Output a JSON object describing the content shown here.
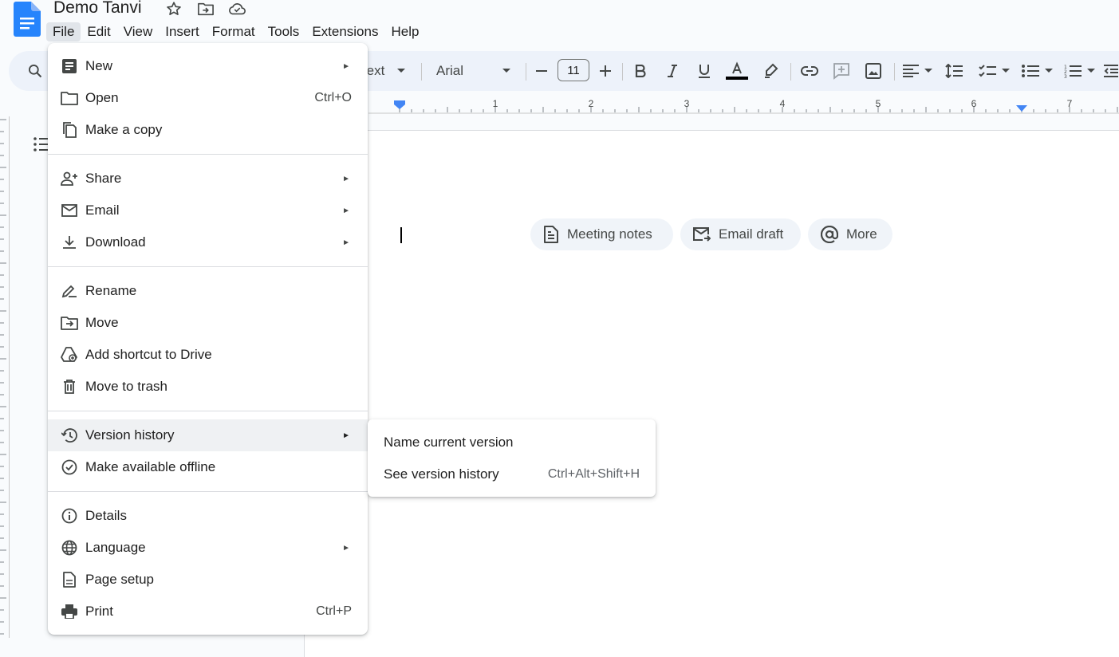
{
  "header": {
    "title": "Demo Tanvi",
    "menus": [
      "File",
      "Edit",
      "View",
      "Insert",
      "Format",
      "Tools",
      "Extensions",
      "Help"
    ],
    "active_menu": "File"
  },
  "toolbar": {
    "style_partial": "ext",
    "font": "Arial",
    "font_size": "11"
  },
  "ruler": {
    "ticks": [
      "1",
      "2",
      "3",
      "4",
      "5",
      "6",
      "7"
    ]
  },
  "document": {
    "chips": [
      {
        "label": "Meeting notes",
        "icon": "document-icon"
      },
      {
        "label": "Email draft",
        "icon": "email-draft-icon"
      },
      {
        "label": "More",
        "icon": "at-sign-icon"
      }
    ]
  },
  "file_menu": {
    "items": [
      {
        "label": "New",
        "shortcut": "",
        "icon": "new-doc-icon",
        "submenu": true
      },
      {
        "label": "Open",
        "shortcut": "Ctrl+O",
        "icon": "folder-icon",
        "submenu": false
      },
      {
        "label": "Make a copy",
        "shortcut": "",
        "icon": "copy-icon",
        "submenu": false
      },
      {
        "label": "Share",
        "shortcut": "",
        "icon": "person-add-icon",
        "submenu": true
      },
      {
        "label": "Email",
        "shortcut": "",
        "icon": "mail-icon",
        "submenu": true
      },
      {
        "label": "Download",
        "shortcut": "",
        "icon": "download-icon",
        "submenu": true
      },
      {
        "label": "Rename",
        "shortcut": "",
        "icon": "rename-icon",
        "submenu": false
      },
      {
        "label": "Move",
        "shortcut": "",
        "icon": "move-folder-icon",
        "submenu": false
      },
      {
        "label": "Add shortcut to Drive",
        "shortcut": "",
        "icon": "drive-shortcut-icon",
        "submenu": false
      },
      {
        "label": "Move to trash",
        "shortcut": "",
        "icon": "trash-icon",
        "submenu": false
      },
      {
        "label": "Version history",
        "shortcut": "",
        "icon": "history-icon",
        "submenu": true
      },
      {
        "label": "Make available offline",
        "shortcut": "",
        "icon": "offline-check-icon",
        "submenu": false
      },
      {
        "label": "Details",
        "shortcut": "",
        "icon": "info-icon",
        "submenu": false
      },
      {
        "label": "Language",
        "shortcut": "",
        "icon": "globe-icon",
        "submenu": true
      },
      {
        "label": "Page setup",
        "shortcut": "",
        "icon": "page-setup-icon",
        "submenu": false
      },
      {
        "label": "Print",
        "shortcut": "Ctrl+P",
        "icon": "print-icon",
        "submenu": false
      }
    ]
  },
  "version_submenu": {
    "items": [
      {
        "label": "Name current version",
        "shortcut": ""
      },
      {
        "label": "See version history",
        "shortcut": "Ctrl+Alt+Shift+H"
      }
    ]
  }
}
